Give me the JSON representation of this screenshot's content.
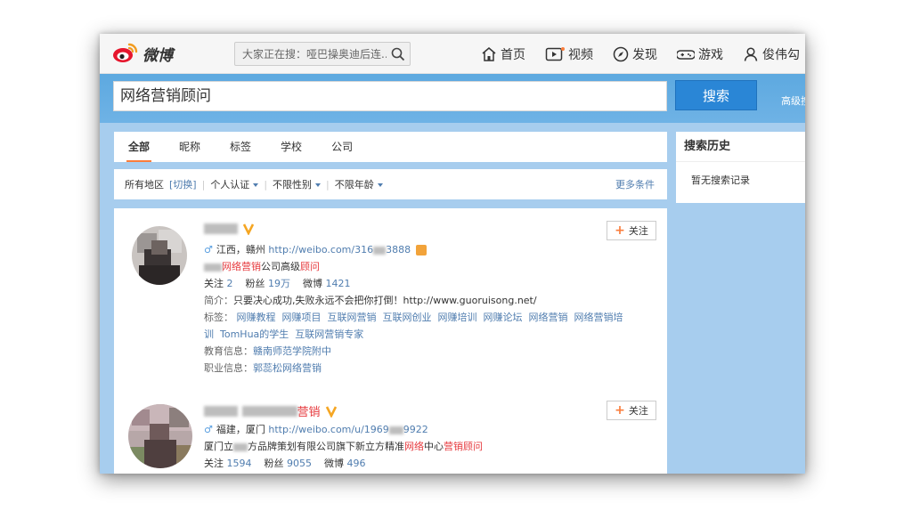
{
  "nav": {
    "logo_text": "微博",
    "search_placeholder": "大家正在搜：哑巴操奥迪后连...",
    "links": [
      "首页",
      "视频",
      "发现",
      "游戏",
      "俊伟勾"
    ]
  },
  "search": {
    "query": "网络营销顾问",
    "button": "搜索",
    "advanced": "高级搜"
  },
  "tabs": [
    "全部",
    "昵称",
    "标签",
    "学校",
    "公司"
  ],
  "filters": {
    "region_label": "所有地区",
    "region_switch": "[切换]",
    "verify": "个人认证",
    "gender": "不限性别",
    "age": "不限年龄",
    "more": "更多条件"
  },
  "sidebar": {
    "title": "搜索历史",
    "empty": "暂无搜索记录"
  },
  "results": [
    {
      "location": "江西，赣州",
      "url_a": "http://weibo.com/316",
      "url_b": "3888",
      "desc_hl": "网络营销",
      "desc_mid": "公司高级",
      "desc_hl2": "顾问",
      "follow_label": "关注",
      "follow_count": "2",
      "fans_label": "粉丝",
      "fans_count": "19万",
      "weibo_label": "微博",
      "weibo_count": "1421",
      "intro_label": "简介：",
      "intro": "只要决心成功,失败永远不会把你打倒！http://www.guoruisong.net/",
      "tags_label": "标签：",
      "tags_line1": [
        "网赚教程",
        "网赚项目",
        "互联网营销",
        "互联网创业",
        "网赚培训",
        "网赚论坛",
        "网络营销",
        "网络营销培"
      ],
      "tags_line2": [
        "训",
        "TomHua的学生",
        "互联网营销专家"
      ],
      "edu_label": "教育信息：",
      "edu": "赣南师范学院附中",
      "job_label": "职业信息：",
      "job": "郭蕊松网络营销",
      "follow_button": "关注"
    },
    {
      "name_hl": "营销",
      "location": "福建，厦门",
      "url_a": "http://weibo.com/u/1969",
      "url_b": "9922",
      "desc_a": "厦门立",
      "desc_b": "方品牌策划有限公司旗下新立方精准",
      "desc_hl": "网络",
      "desc_c": "中心",
      "desc_hl2": "营销顾问",
      "follow_label": "关注",
      "follow_count": "1594",
      "fans_label": "粉丝",
      "fans_count": "9055",
      "weibo_label": "微博",
      "weibo_count": "496",
      "follow_button": "关注"
    }
  ],
  "colors": {
    "accent_orange": "#fa7d3c",
    "link_blue": "#507daf",
    "highlight_red": "#e6393d",
    "brand_blue": "#2a86d6"
  }
}
